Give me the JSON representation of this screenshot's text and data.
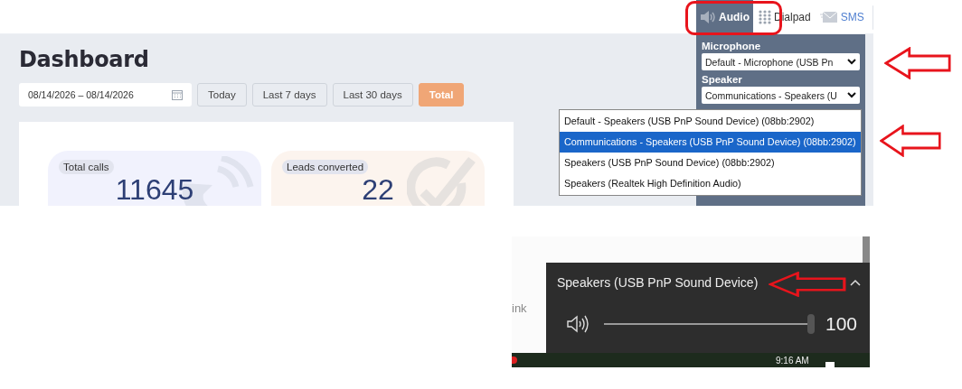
{
  "top_nav": {
    "tabs": [
      {
        "label": "Audio",
        "selected": true,
        "kind": "audio"
      },
      {
        "label": "Dialpad",
        "selected": false,
        "kind": "dialpad"
      },
      {
        "label": "SMS",
        "selected": false,
        "kind": "sms"
      }
    ]
  },
  "dashboard": {
    "title": "Dashboard",
    "date_range": "08/14/2026 – 08/14/2026",
    "range_buttons": [
      {
        "label": "Today",
        "selected": false
      },
      {
        "label": "Last 7 days",
        "selected": false
      },
      {
        "label": "Last 30 days",
        "selected": false
      },
      {
        "label": "Total",
        "selected": true
      }
    ],
    "stats": [
      {
        "label": "Total calls",
        "value": "11645",
        "kind": "calls"
      },
      {
        "label": "Leads converted",
        "value": "22",
        "kind": "leads"
      }
    ]
  },
  "audio_panel": {
    "microphone_label": "Microphone",
    "microphone_value": "Default - Microphone (USB Pn",
    "speaker_label": "Speaker",
    "speaker_value": "Communications - Speakers (U",
    "speaker_options": [
      {
        "label": "Default - Speakers (USB PnP Sound Device) (08bb:2902)",
        "selected": false
      },
      {
        "label": "Communications - Speakers (USB PnP Sound Device) (08bb:2902)",
        "selected": true
      },
      {
        "label": "Speakers (USB PnP Sound Device) (08bb:2902)",
        "selected": false
      },
      {
        "label": "Speakers (Realtek High Definition Audio)",
        "selected": false
      }
    ]
  },
  "page_fragment": "ink",
  "sound_flyout": {
    "device": "Speakers (USB PnP Sound Device)",
    "level": 1,
    "reading": "100"
  },
  "taskbar": {
    "time": "9:16 AM"
  },
  "annotations": [
    {
      "kind": "ring"
    },
    {
      "kind": "arrow"
    },
    {
      "kind": "arrow"
    },
    {
      "kind": "arrow"
    }
  ]
}
